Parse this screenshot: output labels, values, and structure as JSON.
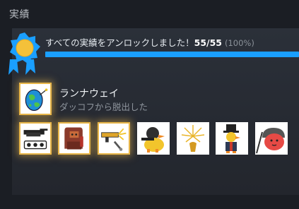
{
  "section": {
    "title": "実績"
  },
  "summary": {
    "message": "すべての実績をアンロックしました！",
    "count": "55/55",
    "percent": "(100%)",
    "progress_fraction": 1.0,
    "accent_color": "#1a9fff"
  },
  "featured": {
    "name": "ランナウェイ",
    "description": "ダッコフから脱出した",
    "icon": "egg-globe-icon"
  },
  "thumbnails": [
    {
      "icon": "tank-icon",
      "highlight": true
    },
    {
      "icon": "hooded-figure-icon",
      "highlight": true
    },
    {
      "icon": "gun-sparkle-icon",
      "highlight": true
    },
    {
      "icon": "soldier-duck-icon",
      "highlight": false
    },
    {
      "icon": "firework-icon",
      "highlight": false
    },
    {
      "icon": "top-hat-duck-icon",
      "highlight": false
    },
    {
      "icon": "red-helmet-duck-icon",
      "highlight": false
    }
  ]
}
